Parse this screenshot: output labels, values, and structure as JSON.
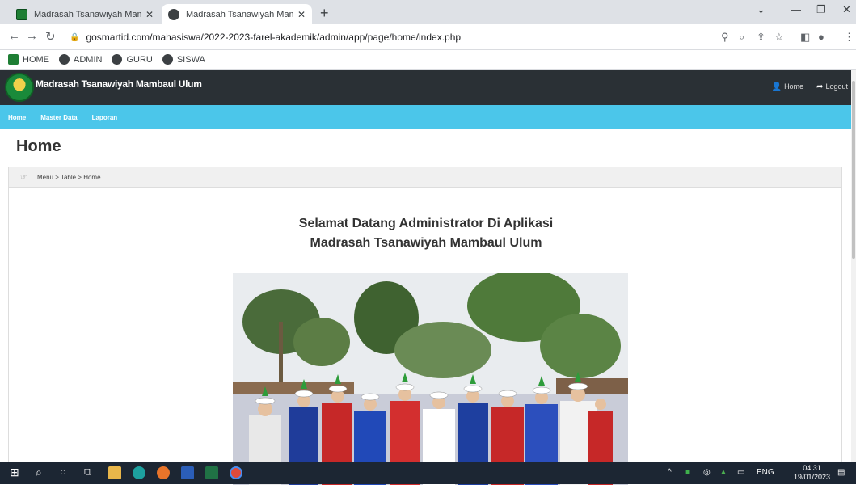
{
  "browser": {
    "tabs": [
      {
        "title": "Madrasah Tsanawiyah Mambaul",
        "active": false
      },
      {
        "title": "Madrasah Tsanawiyah Mambaul",
        "active": true
      }
    ],
    "url": "gosmartid.com/mahasiswa/2022-2023-farel-akademik/admin/app/page/home/index.php",
    "bookmarks": [
      "HOME",
      "ADMIN",
      "GURU",
      "SISWA"
    ]
  },
  "site": {
    "name": "Madrasah Tsanawiyah Mambaul Ulum",
    "top_links": {
      "home": "Home",
      "logout": "Logout"
    },
    "menu": [
      "Home",
      "Master Data",
      "Laporan"
    ],
    "page_title": "Home",
    "breadcrumb": "Menu > Table > Home",
    "welcome_line1": "Selamat Datang Administrator Di Aplikasi",
    "welcome_line2": "Madrasah Tsanawiyah Mambaul Ulum"
  },
  "taskbar": {
    "lang": "ENG",
    "time": "04.31",
    "date": "19/01/2023"
  }
}
